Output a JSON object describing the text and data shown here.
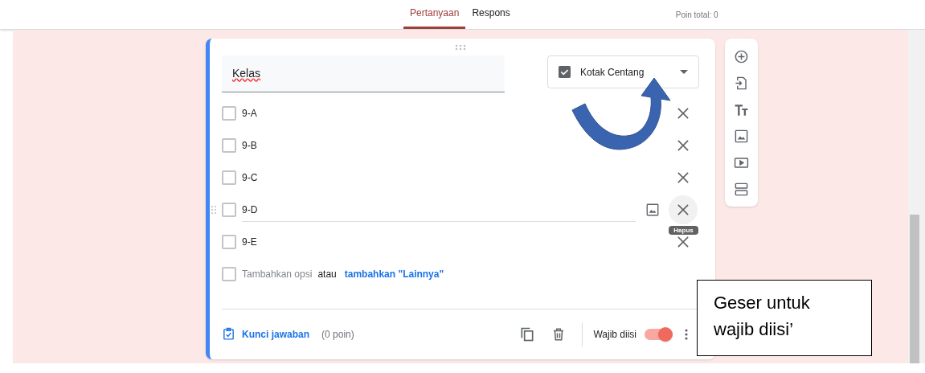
{
  "tabs": [
    {
      "label": "Pertanyaan",
      "selected": true
    },
    {
      "label": "Respons",
      "selected": false
    }
  ],
  "points_total": "Poin total: 0",
  "question": {
    "title": "Kelas",
    "type": "Kotak Centang",
    "options": [
      {
        "label": "9-A",
        "checked": false,
        "focused": false
      },
      {
        "label": "9-B",
        "checked": false,
        "focused": false
      },
      {
        "label": "9-C",
        "checked": false,
        "focused": false
      },
      {
        "label": "9-D",
        "checked": false,
        "focused": true
      },
      {
        "label": "9-E",
        "checked": false,
        "focused": false
      }
    ],
    "add_option": {
      "checked": false,
      "placeholder": "Tambahkan opsi",
      "separator": "atau",
      "other_link": "tambahkan \"Lainnya\""
    },
    "tooltip": "Hapus",
    "answer_key": "Kunci jawaban",
    "points": "(0 poin)",
    "required_label": "Wajib diisi",
    "required": true
  },
  "callout": "Geser untuk wajib diisi’"
}
